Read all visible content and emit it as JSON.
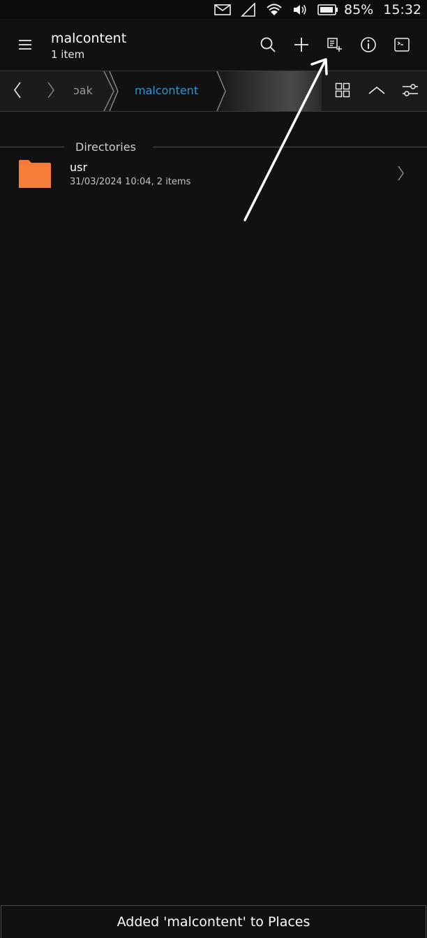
{
  "status_bar": {
    "battery_percent": "85%",
    "time": "15:32",
    "icons": [
      "message-icon",
      "signal-icon",
      "wifi-icon",
      "volume-icon",
      "battery-icon"
    ]
  },
  "header": {
    "title": "malcontent",
    "subtitle": "1 item",
    "actions": [
      "menu-icon",
      "search-icon",
      "add-icon",
      "bookmark-add-icon",
      "info-icon",
      "terminal-icon"
    ]
  },
  "pathbar": {
    "crumbs": [
      "pak",
      "malcontent"
    ],
    "visible_prev_crumb": "ɔak",
    "current": "malcontent",
    "actions": [
      "grid-view-icon",
      "chevron-up-icon",
      "settings-sliders-icon"
    ]
  },
  "list": {
    "section_header": "Directories",
    "items": [
      {
        "name": "usr",
        "meta": "31/03/2024 10:04, 2 items"
      }
    ]
  },
  "toast": {
    "message": "Added 'malcontent' to Places"
  },
  "colors": {
    "background": "#111111",
    "accent": "#2c95d8",
    "folder": "#f47a36"
  }
}
